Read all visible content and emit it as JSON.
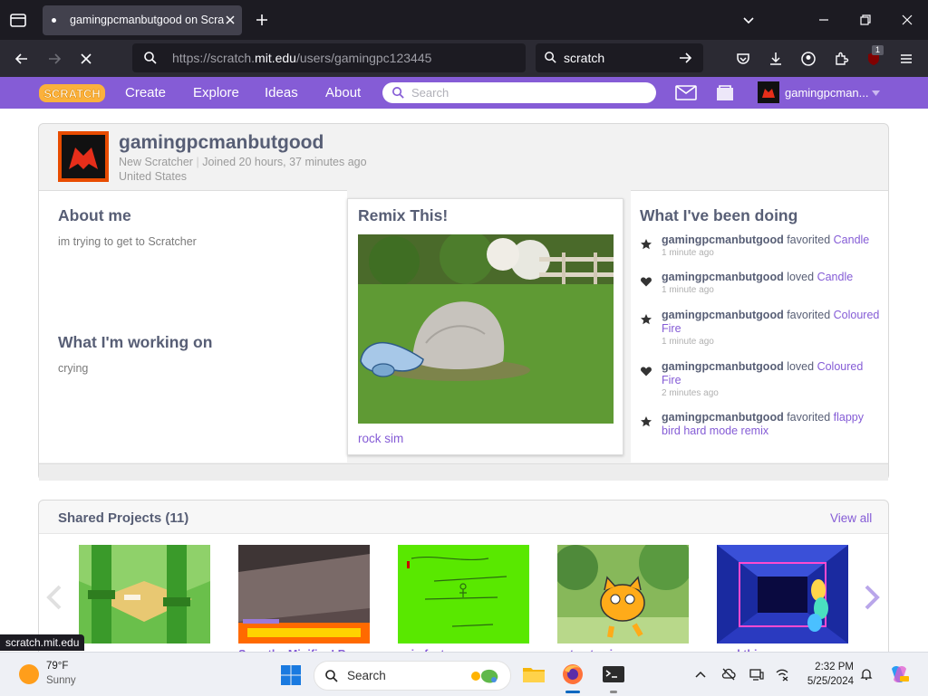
{
  "browser": {
    "tab_title": "gamingpcmanbutgood on Scratch",
    "url_prefix": "https://scratch.",
    "url_domain": "mit.edu",
    "url_path": "/users/gamingpc123445",
    "search_value": "scratch",
    "extension_badge": "1",
    "status_url": "scratch.mit.edu"
  },
  "scratch_nav": {
    "logo_text": "SCRATCH",
    "links": [
      "Create",
      "Explore",
      "Ideas",
      "About"
    ],
    "search_placeholder": "Search",
    "username": "gamingpcman..."
  },
  "profile": {
    "username": "gamingpcmanbutgood",
    "rank": "New Scratcher",
    "joined": "Joined 20 hours, 37 minutes ago",
    "country": "United States",
    "about_heading": "About me",
    "about_text": "im trying to get to Scratcher",
    "working_heading": "What I'm working on",
    "working_text": "crying"
  },
  "remix": {
    "heading": "Remix This!",
    "project_title": "rock sim"
  },
  "activity": {
    "heading": "What I've been doing",
    "items": [
      {
        "icon": "star-icon",
        "user": "gamingpcmanbutgood",
        "action": "favorited",
        "project": "Candle",
        "time": "1 minute ago"
      },
      {
        "icon": "heart-icon",
        "user": "gamingpcmanbutgood",
        "action": "loved",
        "project": "Candle",
        "time": "1 minute ago"
      },
      {
        "icon": "star-icon",
        "user": "gamingpcmanbutgood",
        "action": "favorited",
        "project": "Coloured Fire",
        "time": "1 minute ago"
      },
      {
        "icon": "heart-icon",
        "user": "gamingpcmanbutgood",
        "action": "loved",
        "project": "Coloured Fire",
        "time": "2 minutes ago"
      },
      {
        "icon": "star-icon",
        "user": "gamingpcmanbutgood",
        "action": "favorited",
        "project": "flappy bird hard mode remix",
        "time": ""
      }
    ]
  },
  "shared": {
    "heading": "Shared Projects (11)",
    "view_all": "View all",
    "projects": [
      {
        "title": ""
      },
      {
        "title": "Save the Minifigs! B..."
      },
      {
        "title": "coin fast"
      },
      {
        "title": "cat gets air"
      },
      {
        "title": "cool thing"
      }
    ]
  },
  "taskbar": {
    "temperature": "79°F",
    "weather": "Sunny",
    "search_label": "Search",
    "time": "2:32 PM",
    "date": "5/25/2024"
  },
  "colors": {
    "scratch_purple": "#855cd6",
    "browser_dark": "#1c1b22",
    "text_gray": "#575e75"
  }
}
